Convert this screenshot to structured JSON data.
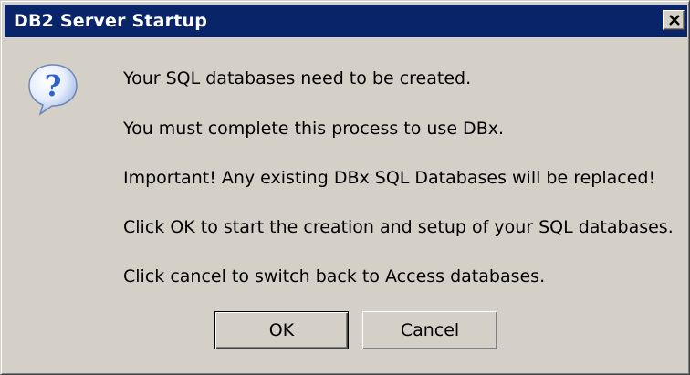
{
  "window": {
    "title": "DB2 Server Startup",
    "close_glyph": "close-icon"
  },
  "icon": {
    "name": "question-icon",
    "glyph": "?"
  },
  "messages": [
    "Your SQL databases need to be created.",
    "You must complete this process to use DBx.",
    "Important! Any existing DBx SQL Databases will be replaced!",
    "Click OK to start the creation and setup of your SQL databases.",
    "Click cancel to switch back to Access databases."
  ],
  "buttons": {
    "ok_label": "OK",
    "cancel_label": "Cancel"
  },
  "colors": {
    "titlebar": "#0a246a",
    "dialog_face": "#d4d0c8",
    "icon_blue": "#2e62c8"
  }
}
